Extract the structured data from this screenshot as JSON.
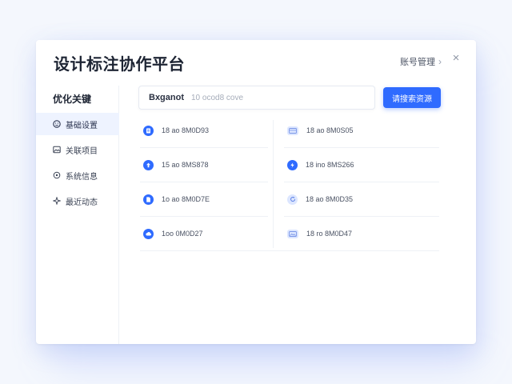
{
  "app": {
    "title": "设计标注协作平台",
    "top_link": "账号管理",
    "close_symbol": "×"
  },
  "sidebar": {
    "heading": "优化关键",
    "items": [
      {
        "label": "基础设置",
        "icon": "smile-icon",
        "active": true
      },
      {
        "label": "关联项目",
        "icon": "image-icon",
        "active": false
      },
      {
        "label": "系统信息",
        "icon": "target-icon",
        "active": false
      },
      {
        "label": "最近动态",
        "icon": "spark-icon",
        "active": false
      }
    ]
  },
  "search": {
    "label": "Bxganot",
    "placeholder": "10 ocod8 cove"
  },
  "primary_button": {
    "label": "请搜索资源"
  },
  "files": [
    {
      "name": "18 ao 8M0D93",
      "icon": "document-icon",
      "style": "solid"
    },
    {
      "name": "18 ao 8M0S05",
      "icon": "folder-icon",
      "style": "light"
    },
    {
      "name": "15 ao 8MS878",
      "icon": "upload-icon",
      "style": "solid"
    },
    {
      "name": "18 ino 8MS266",
      "icon": "bolt-icon",
      "style": "solid"
    },
    {
      "name": "1o ao 8M0D7E",
      "icon": "file-icon",
      "style": "solid"
    },
    {
      "name": "18 ao 8M0D35",
      "icon": "refresh-icon",
      "style": "light"
    },
    {
      "name": "1oo 0M0D27",
      "icon": "cloud-icon",
      "style": "solid"
    },
    {
      "name": "18 ro 8M0D47",
      "icon": "image-icon",
      "style": "light"
    }
  ],
  "colors": {
    "accent": "#2f6bff",
    "title_text": "#1d2433",
    "active_bg": "#eef3ff"
  }
}
